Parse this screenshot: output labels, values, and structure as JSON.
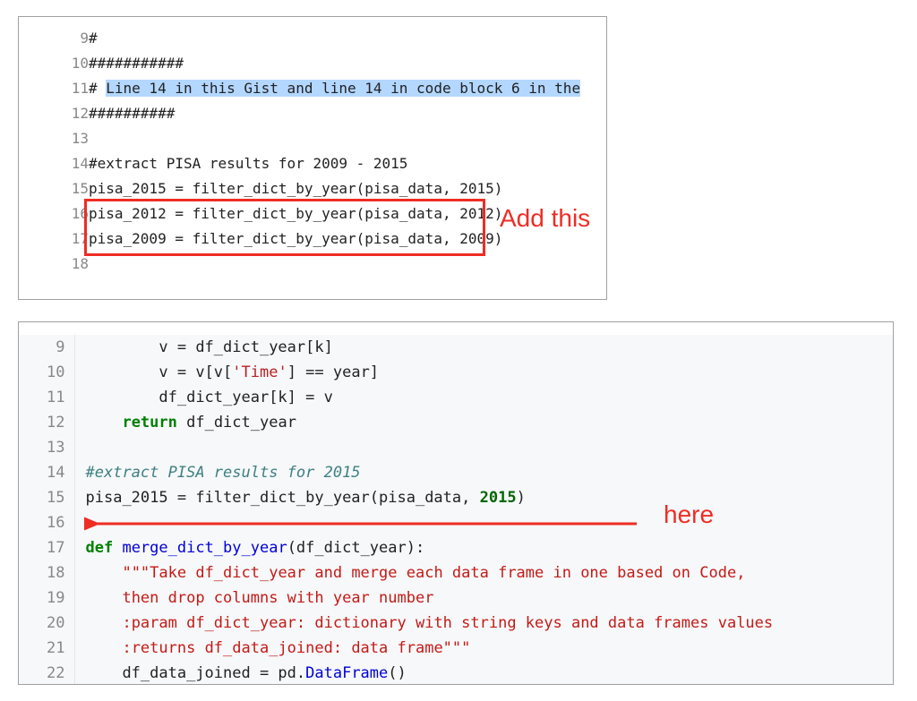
{
  "top": {
    "lines": [
      {
        "n": 9,
        "text": "#"
      },
      {
        "n": 10,
        "text": "###########"
      },
      {
        "n": 11,
        "prefix": "# ",
        "highlighted": "Line 14 in this Gist and line 14 in code block 6 in the"
      },
      {
        "n": 12,
        "text": "##########"
      },
      {
        "n": 13,
        "text": ""
      },
      {
        "n": 14,
        "text": "#extract PISA results for 2009 - 2015"
      },
      {
        "n": 15,
        "text": "pisa_2015 = filter_dict_by_year(pisa_data, 2015)"
      },
      {
        "n": 16,
        "text": "pisa_2012 = filter_dict_by_year(pisa_data, 2012)"
      },
      {
        "n": 17,
        "text": "pisa_2009 = filter_dict_by_year(pisa_data, 2009)"
      },
      {
        "n": 18,
        "text": ""
      }
    ],
    "redbox_lines": [
      16,
      17
    ],
    "annotation": "Add this"
  },
  "bottom": {
    "annotation": "here",
    "lines": [
      {
        "n": 9,
        "segments": [
          {
            "t": "        v = df_dict_year[k]"
          }
        ]
      },
      {
        "n": 10,
        "segments": [
          {
            "t": "        v = v[v["
          },
          {
            "t": "'Time'",
            "cls": "str2"
          },
          {
            "t": "] == year]"
          }
        ]
      },
      {
        "n": 11,
        "segments": [
          {
            "t": "        df_dict_year[k] = v"
          }
        ]
      },
      {
        "n": 12,
        "segments": [
          {
            "t": "    "
          },
          {
            "t": "return",
            "cls": "kw"
          },
          {
            "t": " df_dict_year"
          }
        ]
      },
      {
        "n": 13,
        "segments": [
          {
            "t": ""
          }
        ]
      },
      {
        "n": 14,
        "segments": [
          {
            "t": "#extract PISA results for 2015",
            "cls": "cmt-it"
          }
        ]
      },
      {
        "n": 15,
        "segments": [
          {
            "t": "pisa_2015 = filter_dict_by_year(pisa_data, "
          },
          {
            "t": "2015",
            "cls": "num"
          },
          {
            "t": ")"
          }
        ]
      },
      {
        "n": 16,
        "segments": [
          {
            "t": ""
          }
        ]
      },
      {
        "n": 17,
        "segments": [
          {
            "t": "def ",
            "cls": "kw"
          },
          {
            "t": "merge_dict_by_year",
            "cls": "fn"
          },
          {
            "t": "(df_dict_year):"
          }
        ]
      },
      {
        "n": 18,
        "segments": [
          {
            "t": "    "
          },
          {
            "t": "\"\"\"Take df_dict_year and merge each data frame in one based on Code,",
            "cls": "str"
          }
        ]
      },
      {
        "n": 19,
        "segments": [
          {
            "t": "    "
          },
          {
            "t": "then drop columns with year number",
            "cls": "str"
          }
        ]
      },
      {
        "n": 20,
        "segments": [
          {
            "t": "    "
          },
          {
            "t": ":param df_dict_year: dictionary with string keys and data frames values",
            "cls": "str"
          }
        ]
      },
      {
        "n": 21,
        "segments": [
          {
            "t": "    "
          },
          {
            "t": ":returns df_data_joined: data frame\"\"\"",
            "cls": "str"
          }
        ]
      },
      {
        "n": 22,
        "segments": [
          {
            "t": "    df_data_joined = pd."
          },
          {
            "t": "DataFrame",
            "cls": "fn"
          },
          {
            "t": "()"
          }
        ]
      }
    ]
  }
}
